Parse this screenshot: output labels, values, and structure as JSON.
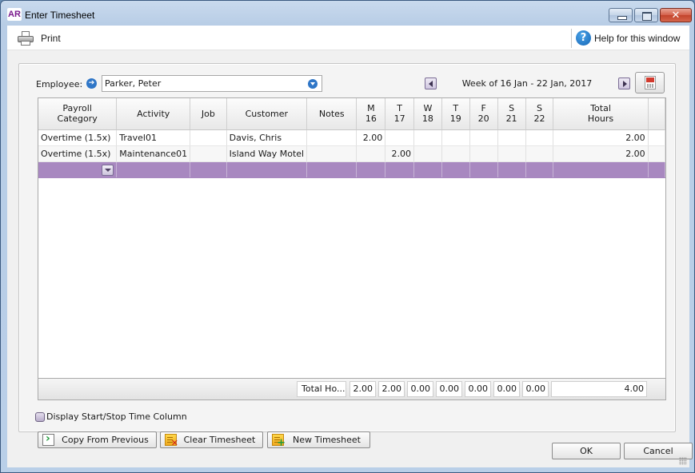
{
  "window": {
    "logo": "AR",
    "title": "Enter Timesheet",
    "controls": {
      "minimize": "minimize",
      "maximize": "maximize",
      "close": "✕"
    }
  },
  "toolbar": {
    "print_label": "Print",
    "help_icon": "?",
    "help_label": "Help for this window"
  },
  "employee": {
    "label": "Employee:",
    "arrow_icon": "➔",
    "value": "Parker, Peter"
  },
  "week": {
    "label": "Week of 16 Jan - 22 Jan, 2017"
  },
  "grid": {
    "headers": [
      {
        "line1": "Payroll",
        "line2": "Category"
      },
      {
        "line1": "Activity",
        "line2": ""
      },
      {
        "line1": "Job",
        "line2": ""
      },
      {
        "line1": "Customer",
        "line2": ""
      },
      {
        "line1": "Notes",
        "line2": ""
      },
      {
        "line1": "M",
        "line2": "16"
      },
      {
        "line1": "T",
        "line2": "17"
      },
      {
        "line1": "W",
        "line2": "18"
      },
      {
        "line1": "T",
        "line2": "19"
      },
      {
        "line1": "F",
        "line2": "20"
      },
      {
        "line1": "S",
        "line2": "21"
      },
      {
        "line1": "S",
        "line2": "22"
      },
      {
        "line1": "Total",
        "line2": "Hours"
      }
    ],
    "rows": [
      {
        "category": "Overtime (1.5x)",
        "activity": "Travel01",
        "job": "",
        "customer": "Davis, Chris",
        "notes": "",
        "mon": "2.00",
        "tue": "",
        "wed": "",
        "thu": "",
        "fri": "",
        "sat": "",
        "sun": "",
        "total": "2.00"
      },
      {
        "category": "Overtime (1.5x)",
        "activity": "Maintenance01",
        "job": "",
        "customer": "Island Way Motel",
        "notes": "",
        "mon": "",
        "tue": "2.00",
        "wed": "",
        "thu": "",
        "fri": "",
        "sat": "",
        "sun": "",
        "total": "2.00"
      }
    ],
    "selected_row_color": "#a888c0"
  },
  "totals": {
    "label": "Total Ho...",
    "mon": "2.00",
    "tue": "2.00",
    "wed": "0.00",
    "thu": "0.00",
    "fri": "0.00",
    "sat": "0.00",
    "sun": "0.00",
    "total": "4.00"
  },
  "options": {
    "start_stop_label": "Display Start/Stop Time Column",
    "start_stop_checked": false
  },
  "actions": {
    "copy_label": "Copy From Previous",
    "clear_label": "Clear Timesheet",
    "new_label": "New Timesheet"
  },
  "dialog": {
    "ok_label": "OK",
    "cancel_label": "Cancel"
  }
}
